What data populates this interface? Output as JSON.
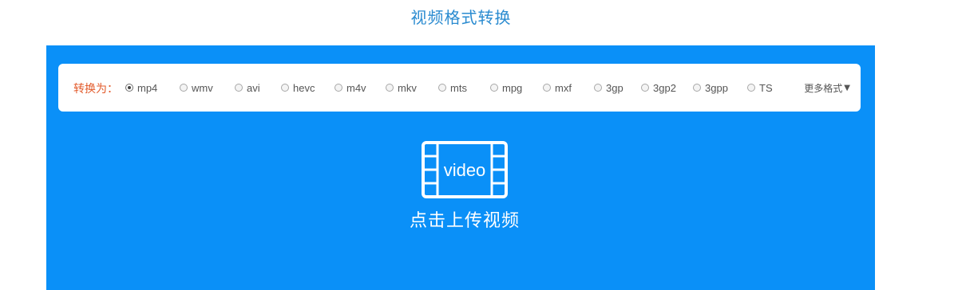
{
  "header": {
    "title": "视频格式转换"
  },
  "format_bar": {
    "label": "转换为：",
    "options": [
      {
        "label": "mp4",
        "selected": true
      },
      {
        "label": "wmv",
        "selected": false
      },
      {
        "label": "avi",
        "selected": false
      },
      {
        "label": "hevc",
        "selected": false
      },
      {
        "label": "m4v",
        "selected": false
      },
      {
        "label": "mkv",
        "selected": false
      },
      {
        "label": "mts",
        "selected": false
      },
      {
        "label": "mpg",
        "selected": false
      },
      {
        "label": "mxf",
        "selected": false
      },
      {
        "label": "3gp",
        "selected": false
      },
      {
        "label": "3gp2",
        "selected": false
      },
      {
        "label": "3gpp",
        "selected": false
      },
      {
        "label": "TS",
        "selected": false
      }
    ],
    "more_label": "更多格式",
    "more_icon": "caret-down-icon"
  },
  "upload": {
    "icon": "video-file-icon",
    "icon_text": "video",
    "label": "点击上传视频"
  },
  "colors": {
    "panel": "#0a90f8",
    "title": "#2a8bd0",
    "label_accent": "#e25a2a"
  }
}
